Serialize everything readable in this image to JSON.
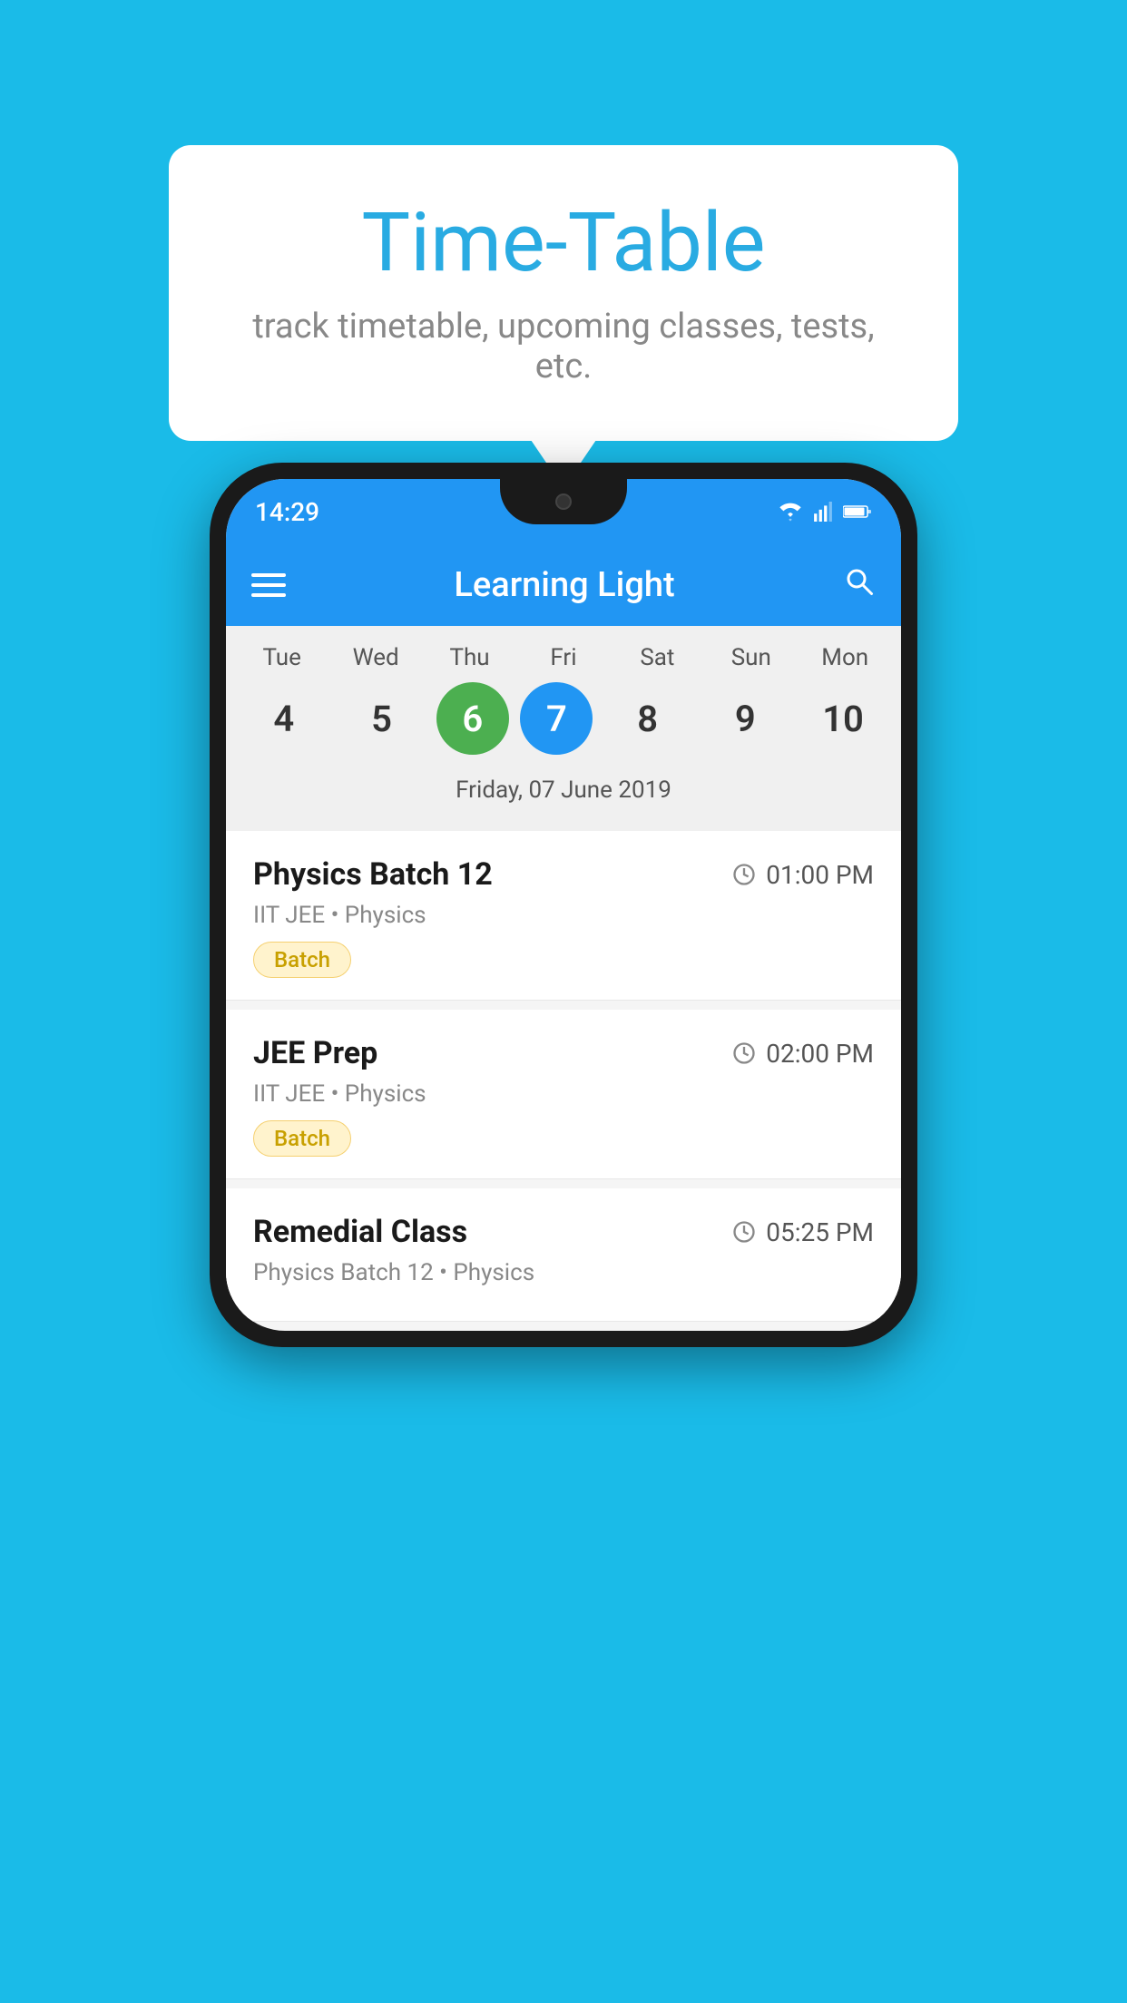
{
  "background_color": "#1ABBE8",
  "bubble": {
    "title": "Time-Table",
    "subtitle": "track timetable, upcoming classes, tests, etc."
  },
  "status_bar": {
    "time": "14:29",
    "wifi": "▾",
    "signal": "▴",
    "battery": "▮"
  },
  "app_bar": {
    "title": "Learning Light",
    "search_icon_label": "search"
  },
  "calendar": {
    "days": [
      {
        "label": "Tue",
        "number": "4"
      },
      {
        "label": "Wed",
        "number": "5"
      },
      {
        "label": "Thu",
        "number": "6",
        "state": "today"
      },
      {
        "label": "Fri",
        "number": "7",
        "state": "selected"
      },
      {
        "label": "Sat",
        "number": "8"
      },
      {
        "label": "Sun",
        "number": "9"
      },
      {
        "label": "Mon",
        "number": "10"
      }
    ],
    "selected_date_label": "Friday, 07 June 2019"
  },
  "schedule": {
    "items": [
      {
        "title": "Physics Batch 12",
        "time": "01:00 PM",
        "subtitle": "IIT JEE • Physics",
        "badge": "Batch"
      },
      {
        "title": "JEE Prep",
        "time": "02:00 PM",
        "subtitle": "IIT JEE • Physics",
        "badge": "Batch"
      },
      {
        "title": "Remedial Class",
        "time": "05:25 PM",
        "subtitle": "Physics Batch 12 • Physics",
        "badge": null
      }
    ]
  }
}
